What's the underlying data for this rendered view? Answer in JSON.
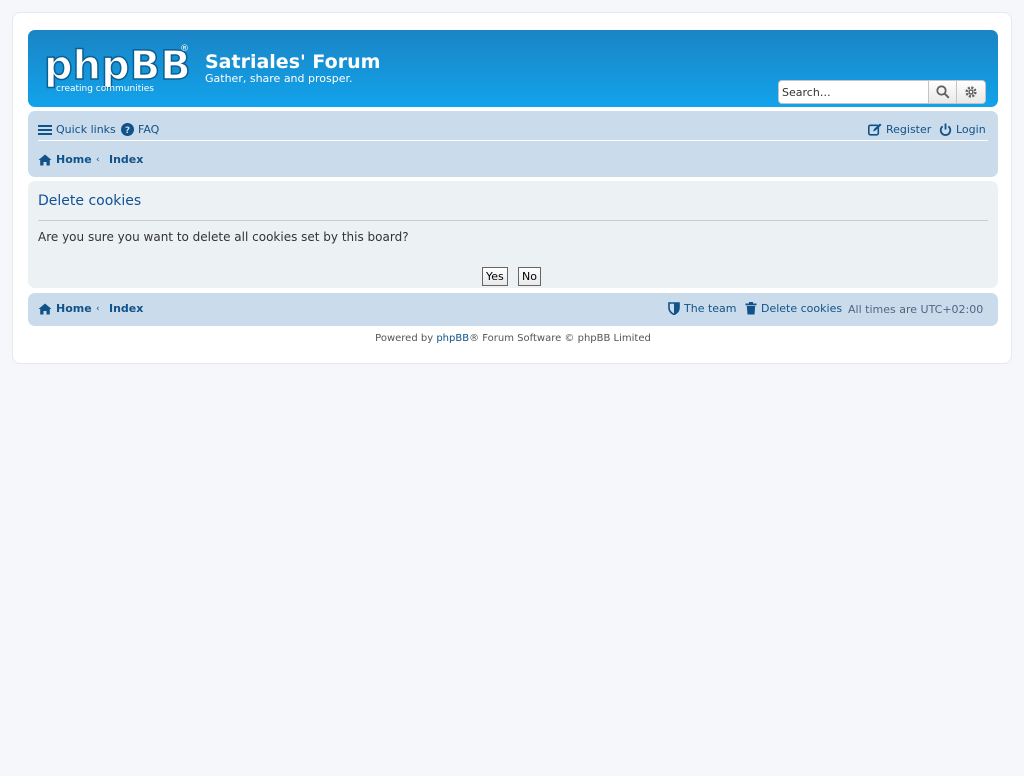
{
  "header": {
    "logo_alt": "phpBB creating communities",
    "site_title": "Satriales' Forum",
    "site_description": "Gather, share and prosper."
  },
  "search": {
    "placeholder": "Search…",
    "search_icon": "search-icon",
    "advanced_icon": "gear-icon"
  },
  "nav": {
    "quick_links": "Quick links",
    "faq": "FAQ",
    "register": "Register",
    "login": "Login",
    "breadcrumb": [
      "Home",
      "Index"
    ]
  },
  "panel": {
    "title": "Delete cookies",
    "question": "Are you sure you want to delete all cookies set by this board?",
    "yes": "Yes",
    "no": "No"
  },
  "footer_nav": {
    "breadcrumb": [
      "Home",
      "Index"
    ],
    "team": "The team",
    "delete_cookies": "Delete cookies",
    "timezone_label": "All times are",
    "timezone": "UTC+02:00"
  },
  "copyright": {
    "powered_by": "Powered by",
    "phpbb_link": "phpBB",
    "rest": "® Forum Software © phpBB Limited"
  },
  "colors": {
    "header_bg": "#12a3eb",
    "nav_bg": "#cadceb",
    "panel_bg": "#ecf1f3",
    "link": "#105289"
  }
}
